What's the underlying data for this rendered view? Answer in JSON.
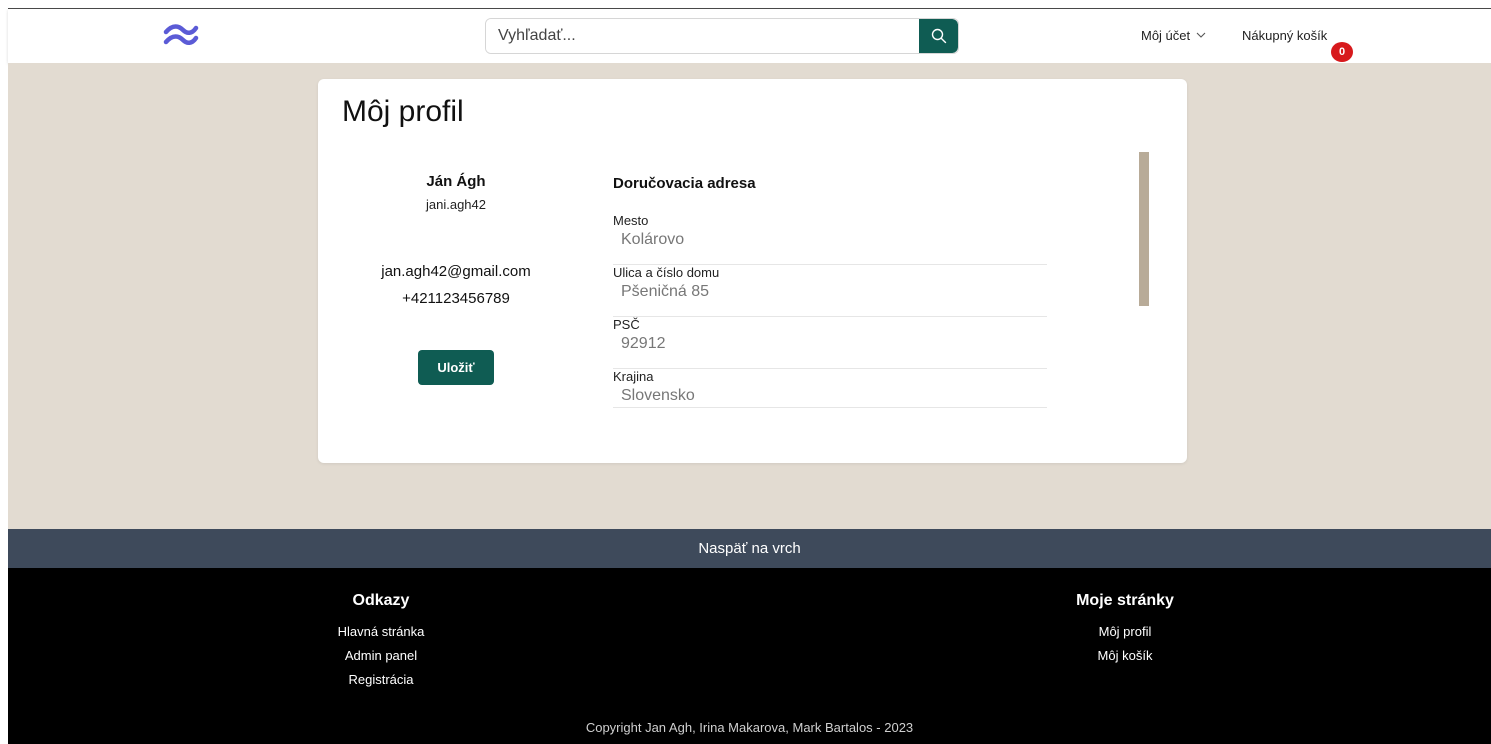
{
  "header": {
    "logo_icon": "wind-wave-logo-icon",
    "search_placeholder": "Vyhľadať...",
    "search_icon": "search-icon",
    "account_label": "Môj účet",
    "account_icon": "chevron-down-icon",
    "cart_label": "Nákupný košík",
    "cart_count": "0"
  },
  "profile": {
    "title": "Môj profil",
    "name": "Ján Ágh",
    "username": "jani.agh42",
    "email": "jan.agh42@gmail.com",
    "phone": "+421123456789",
    "save_label": "Uložiť"
  },
  "address": {
    "title": "Doručovacia adresa",
    "fields": [
      {
        "label": "Mesto",
        "value": "Kolárovo"
      },
      {
        "label": "Ulica a číslo domu",
        "value": "Pšeničná 85"
      },
      {
        "label": "PSČ",
        "value": "92912"
      },
      {
        "label": "Krajina",
        "value": "Slovensko"
      }
    ]
  },
  "footer": {
    "back_to_top": "Naspäť na vrch",
    "links_title": "Odkazy",
    "links": [
      "Hlavná stránka",
      "Admin panel",
      "Registrácia"
    ],
    "pages_title": "Moje stránky",
    "pages": [
      "Môj profil",
      "Môj košík"
    ],
    "copyright": "Copyright Jan Agh, Irina Makarova, Mark Bartalos - 2023"
  },
  "colors": {
    "accent": "#0f5c53",
    "page_bg": "#e2dbd1",
    "badge": "#d7191c",
    "back_to_top_bg": "#3e4a5b",
    "footer_bg": "#000000"
  }
}
